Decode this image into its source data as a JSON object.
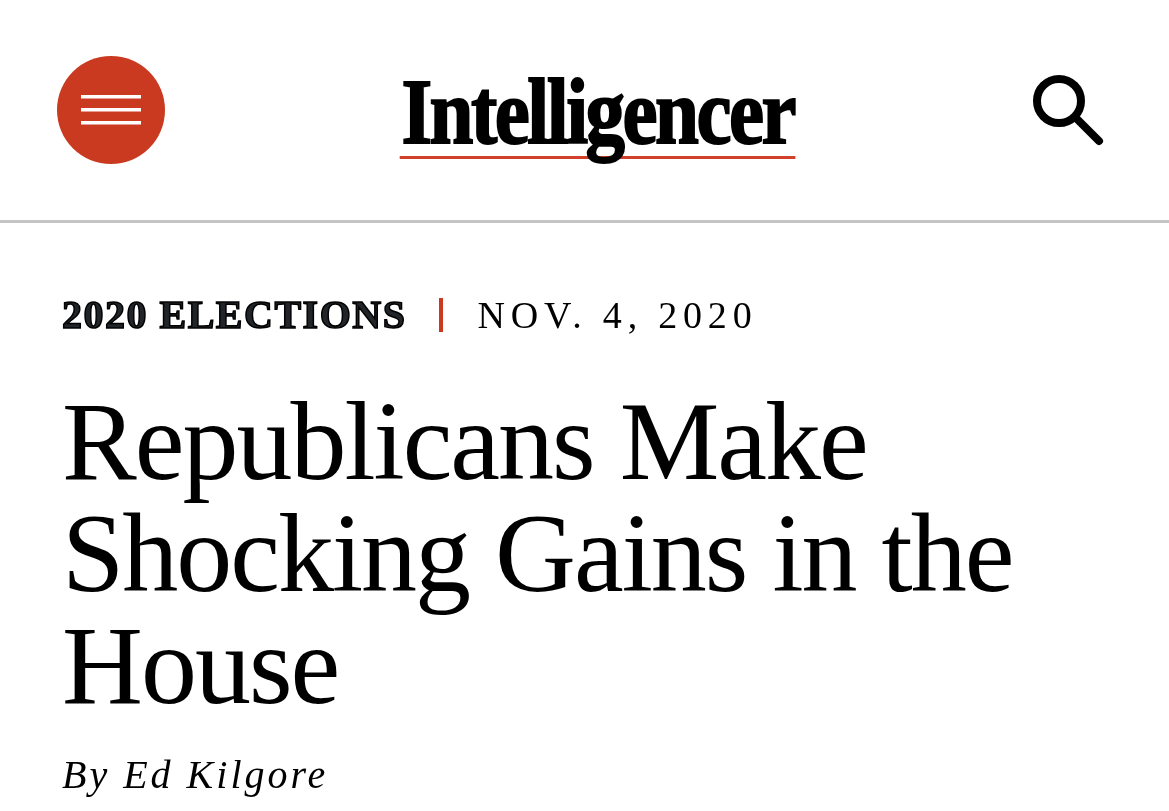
{
  "header": {
    "logo": "Intelligencer"
  },
  "article": {
    "category": "2020 ELECTIONS",
    "date": "NOV. 4, 2020",
    "headline": "Republicans Make Shocking Gains in the House",
    "byline": "By Ed Kilgore"
  }
}
